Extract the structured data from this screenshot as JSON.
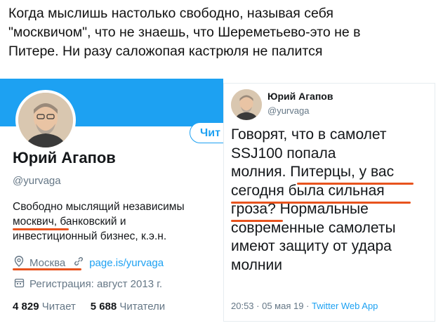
{
  "caption": {
    "line1": "Когда мыслишь настолько свободно, называя себя",
    "line2": "\"москвичом\", что не знаешь, что Шереметьево-это не в",
    "line3": "Питере. Ни разу саложопая кастрюля не палится"
  },
  "profile": {
    "follow_label": "Чит",
    "name": "Юрий Агапов",
    "handle": "@yurvaga",
    "bio_line1": "Свободно мыслящий независимы",
    "bio_line2": "москвич, банковский и",
    "bio_line3": "инвестиционный бизнес, к.э.н.",
    "location": "Москва",
    "website": "page.is/yurvaga",
    "joined": "Регистрация: август 2013 г.",
    "following_count": "4 829",
    "following_label": "Читает",
    "followers_count": "5 688",
    "followers_label": "Читатели",
    "location_icon": "pin-icon",
    "link_icon": "link-icon",
    "calendar_icon": "calendar-icon"
  },
  "tweet": {
    "name": "Юрий Агапов",
    "handle": "@yurvaga",
    "line1": "Говорят, что в самолет",
    "line2": "SSJ100 попала",
    "line3a": "молния. ",
    "line3b": "Питерцы, у вас",
    "line4": "сегодня была сильная",
    "line5a": "гроза?",
    "line5b": " Нормальные",
    "line6": "современные самолеты",
    "line7": "имеют защиту от удара",
    "line8": "молнии",
    "time": "20:53 · 05 мая 19 · ",
    "source": "Twitter Web App"
  },
  "colors": {
    "accent": "#1da1f2",
    "underline": "#e8531e",
    "muted": "#657786"
  }
}
